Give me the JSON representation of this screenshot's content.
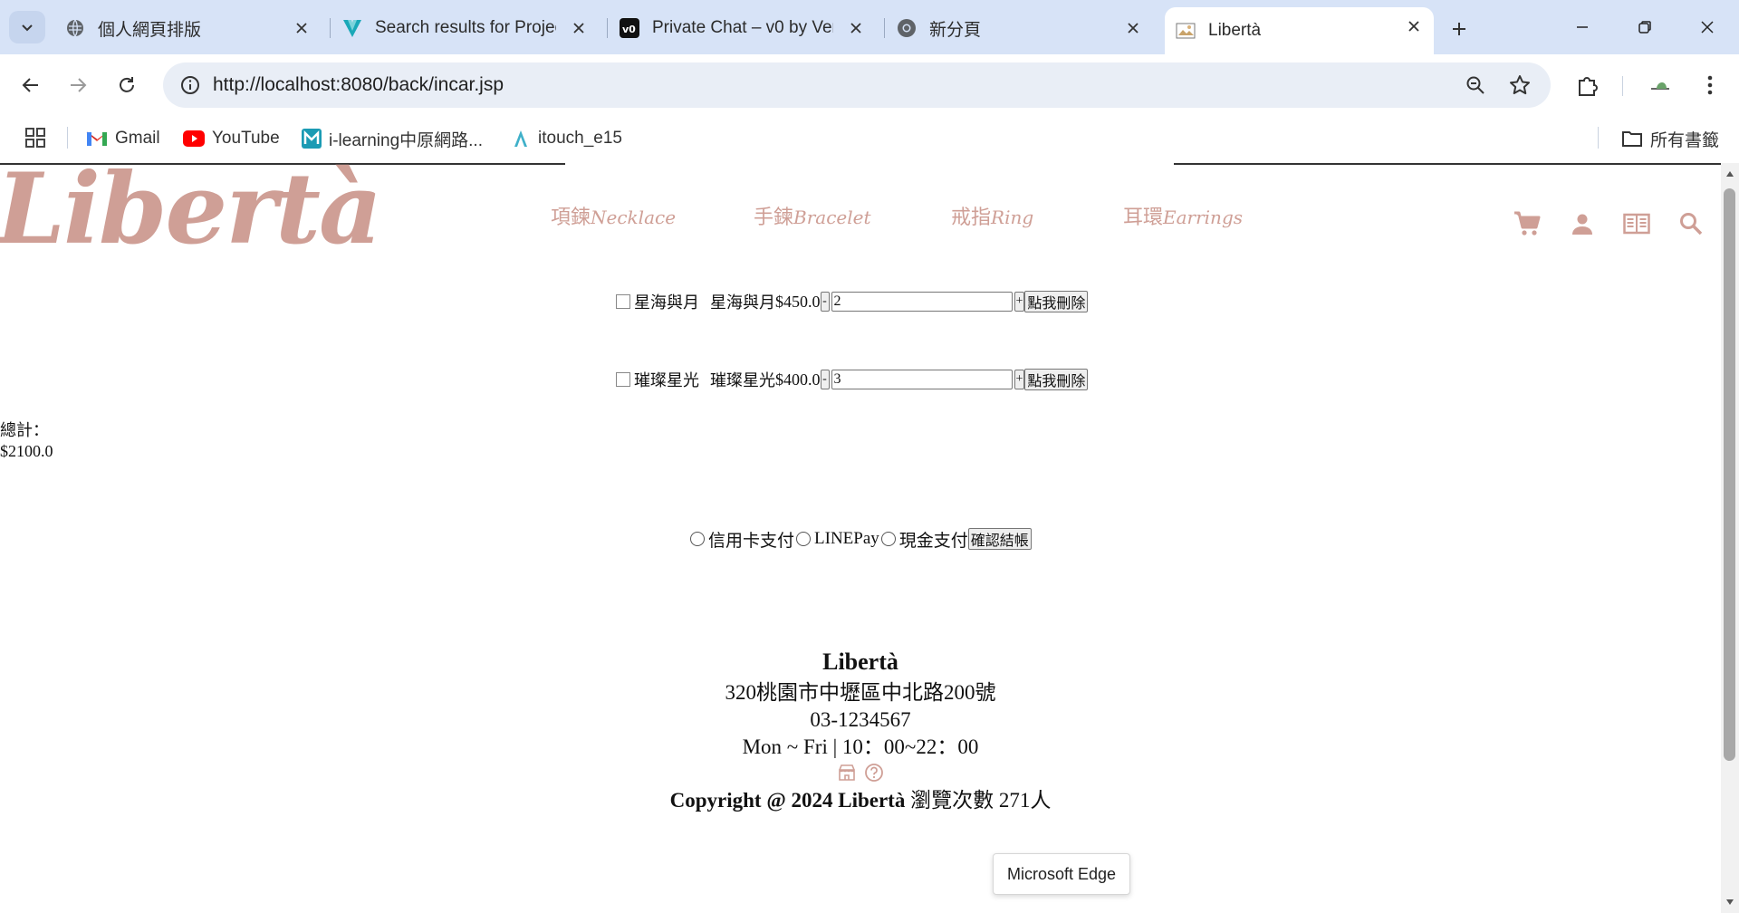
{
  "browser": {
    "tabs": [
      {
        "title": "個人網頁排版",
        "icon": "globe-icon",
        "active": false
      },
      {
        "title": "Search results for Projects",
        "icon": "vuetify-icon",
        "active": false
      },
      {
        "title": "Private Chat – v0 by Vercel",
        "icon": "v0-icon",
        "active": false
      },
      {
        "title": "新分頁",
        "icon": "chrome-icon",
        "active": false
      },
      {
        "title": "Libertà",
        "icon": "site-favicon",
        "active": true
      }
    ],
    "url": "http://localhost:8080/back/incar.jsp",
    "bookmarks": [
      {
        "label": "Gmail",
        "icon": "gmail-icon"
      },
      {
        "label": "YouTube",
        "icon": "youtube-icon"
      },
      {
        "label": "i-learning中原網路...",
        "icon": "ilearning-icon"
      },
      {
        "label": "itouch_e15",
        "icon": "itouch-icon"
      }
    ],
    "all_bookmarks_label": "所有書籤"
  },
  "site": {
    "logo": "Libertà",
    "nav": [
      {
        "zh": "項鍊",
        "en": "Necklace"
      },
      {
        "zh": "手鍊",
        "en": "Bracelet"
      },
      {
        "zh": "戒指",
        "en": "Ring"
      },
      {
        "zh": "耳環",
        "en": "Earrings"
      }
    ],
    "accent_color": "#cf9f96"
  },
  "cart": {
    "items": [
      {
        "img_alt": "星海與月",
        "name": "星海與月",
        "price": "$450.0",
        "qty": "2"
      },
      {
        "img_alt": "璀璨星光",
        "name": "璀璨星光",
        "price": "$400.0",
        "qty": "3"
      }
    ],
    "minus_label": "-",
    "plus_label": "+",
    "delete_label": "點我刪除",
    "total_label": "總計：",
    "total_value": "$2100.0"
  },
  "payment": {
    "options": [
      "信用卡支付",
      "LINEPay",
      "現金支付"
    ],
    "confirm_label": "確認結帳"
  },
  "footer": {
    "brand": "Libertà",
    "address": "320桃園市中壢區中北路200號",
    "phone": "03-1234567",
    "hours": "Mon ~ Fri | 10：00~22：00",
    "copyright": "Copyright @ 2024 Libertà",
    "visits": "瀏覽次數 271人"
  },
  "tooltip": "Microsoft Edge"
}
